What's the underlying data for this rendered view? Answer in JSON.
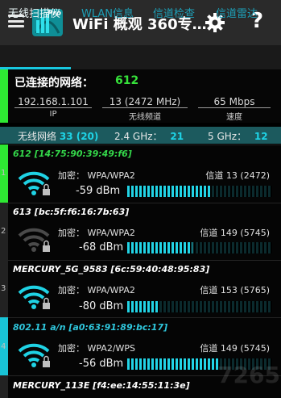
{
  "app": {
    "title": "WiFi 概观 360专…",
    "logo_badge": "Pro"
  },
  "icons": {
    "menu": "menu-icon",
    "settings": "gear-icon",
    "help": "help-icon",
    "wifi": "wifi-lock-icon"
  },
  "colors": {
    "accent": "#18c8e0",
    "connected": "#2ee833",
    "band_bar": "#1c5a5e",
    "background": "#000000"
  },
  "tabs": [
    {
      "label": "无线扫描仪",
      "active": true
    },
    {
      "label": "WLAN信息",
      "active": false
    },
    {
      "label": "信道检查",
      "active": false
    },
    {
      "label": "信道雷达",
      "active": false
    }
  ],
  "summary": {
    "connected_label": "已连接的网络：",
    "connected_count": "612",
    "stats": [
      {
        "value": "192.168.1.101",
        "label": "IP"
      },
      {
        "value": "13 (2472 MHz)",
        "label": "无线频道"
      },
      {
        "value": "65 Mbps",
        "label": "速度"
      }
    ]
  },
  "bands": {
    "label": "无线网络",
    "total": "33 (20)",
    "ghz24_label": "2.4 GHz：",
    "ghz24_count": "21",
    "ghz5_label": "5 GHz：",
    "ghz5_count": "12"
  },
  "networks": [
    {
      "index": "1",
      "title": "612 [14:75:90:39:49:f6]",
      "enc_label": "加密：",
      "enc": "WPA/WPA2",
      "channel": "信道 13 (2472)",
      "dbm": "-59  dBm",
      "signal_level": 0.58
    },
    {
      "index": "2",
      "title": "613 [bc:5f:f6:16:7b:63]",
      "enc_label": "加密：",
      "enc": "WPA/WPA2",
      "channel": "信道 149 (5745)",
      "dbm": "-68  dBm",
      "signal_level": 0.45
    },
    {
      "index": "3",
      "title": "MERCURY_5G_9583 [6c:59:40:48:95:83]",
      "enc_label": "加密：",
      "enc": "WPA/WPA2",
      "channel": "信道 153 (5765)",
      "dbm": "-80  dBm",
      "signal_level": 0.21
    },
    {
      "index": "4",
      "title": "802.11 a/n [a0:63:91:89:bc:17]",
      "enc_label": "加密：",
      "enc": "WPA2/WPS",
      "channel": "信道 149 (5745)",
      "dbm": "-56  dBm",
      "signal_level": 0.63
    },
    {
      "index": "5",
      "title": "MERCURY_113E [f4:ee:14:55:11:3e]"
    }
  ],
  "watermark": "7265"
}
